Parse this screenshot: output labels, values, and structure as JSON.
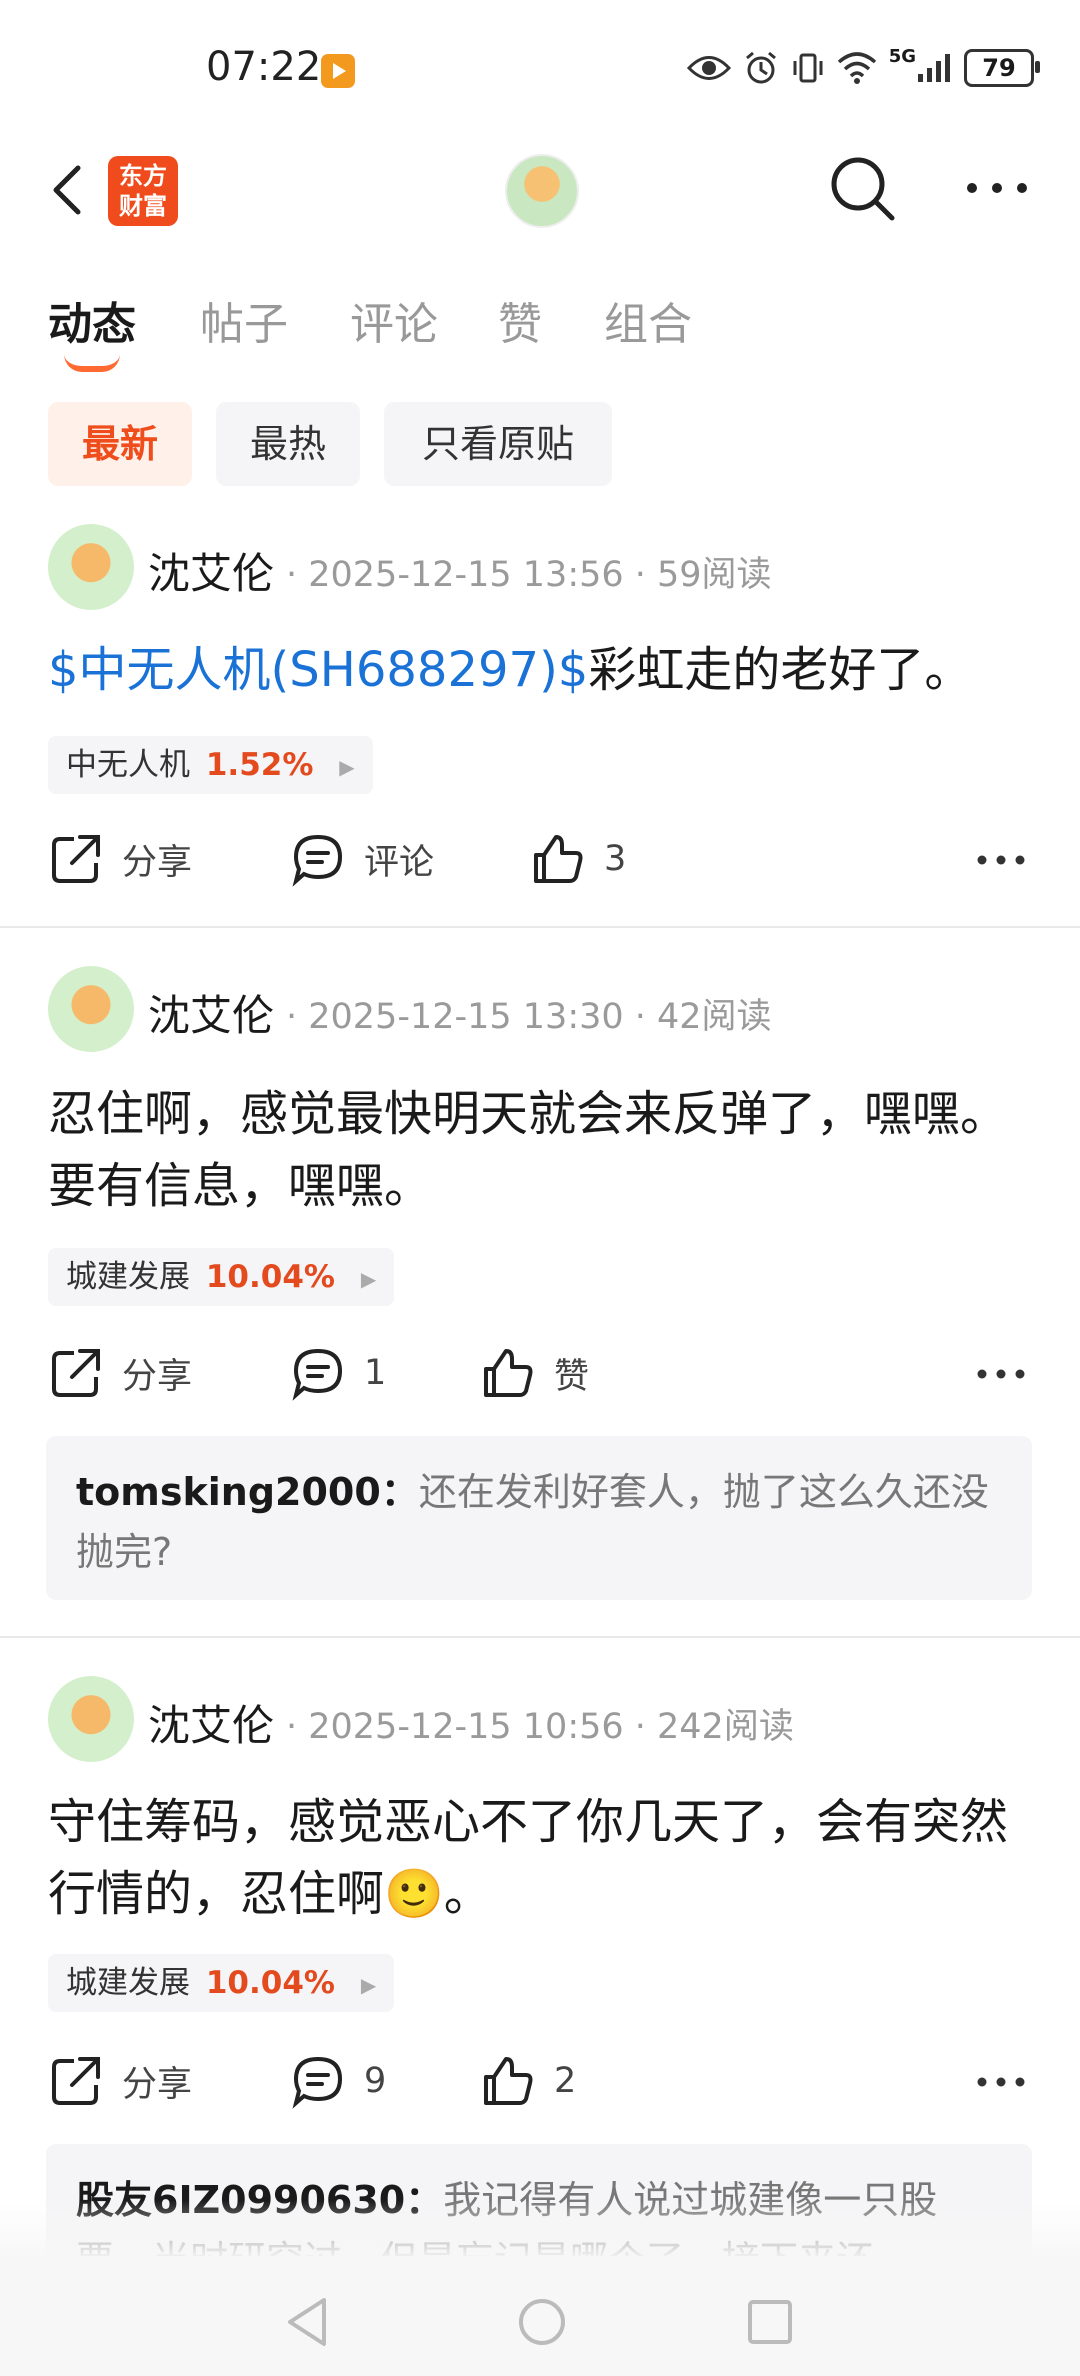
{
  "status_bar": {
    "time": "07:22",
    "network": "5G",
    "battery": "79"
  },
  "header": {
    "logo_line1": "东方",
    "logo_line2": "财富"
  },
  "tabs": [
    {
      "label": "动态",
      "active": true
    },
    {
      "label": "帖子",
      "active": false
    },
    {
      "label": "评论",
      "active": false
    },
    {
      "label": "赞",
      "active": false
    },
    {
      "label": "组合",
      "active": false
    }
  ],
  "filters": [
    {
      "label": "最新",
      "active": true
    },
    {
      "label": "最热",
      "active": false
    },
    {
      "label": "只看原贴",
      "active": false
    }
  ],
  "posts": [
    {
      "author": "沈艾伦",
      "meta": "· 2025-12-15 13:56 · 59阅读",
      "stock_link": "$中无人机(SH688297)$",
      "content": "彩虹走的老好了。",
      "stock_name": "中无人机",
      "stock_pct": "1.52%",
      "share": "分享",
      "comment": "评论",
      "like": "3"
    },
    {
      "author": "沈艾伦",
      "meta": "· 2025-12-15 13:30 · 42阅读",
      "content": "忍住啊，感觉最快明天就会来反弹了，嘿嘿。要有信息，嘿嘿。",
      "stock_name": "城建发展",
      "stock_pct": "10.04%",
      "share": "分享",
      "comment": "1",
      "like": "赞",
      "reply_user": "tomsking2000",
      "reply_text": "还在发利好套人，抛了这么久还没抛完?"
    },
    {
      "author": "沈艾伦",
      "meta": "· 2025-12-15 10:56 · 242阅读",
      "content": "守住筹码，感觉恶心不了你几天了，会有突然行情的，忍住啊",
      "emoji": "🙂",
      "content_end": "。",
      "stock_name": "城建发展",
      "stock_pct": "10.04%",
      "share": "分享",
      "comment": "9",
      "like": "2",
      "reply_user": "股友6IZ0990630",
      "reply_text": "我记得有人说过城建像一只股票，当时研究过，但是忘记是哪个了，接下来还"
    }
  ],
  "colors": {
    "accent": "#f04d1d",
    "link": "#1a72d6",
    "up": "#e34a1e"
  }
}
